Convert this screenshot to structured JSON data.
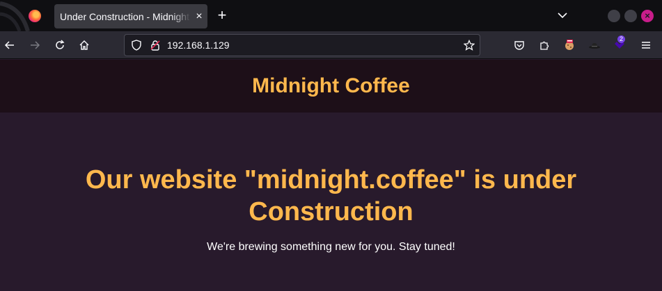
{
  "browser": {
    "tab_title": "Under Construction - Midnight Coffee",
    "tab_close": "×",
    "new_tab": "+",
    "url": "192.168.1.129",
    "extension_badge": "2"
  },
  "page": {
    "site_title": "Midnight Coffee",
    "hero_line1": "Our website \"midnight.coffee\" is under",
    "hero_line2": "Construction",
    "subtitle": "We're brewing something new for you. Stay tuned!"
  },
  "colors": {
    "accent": "#ffb84d",
    "page_bg": "#281a2c",
    "header_bg": "#1d0f18"
  }
}
